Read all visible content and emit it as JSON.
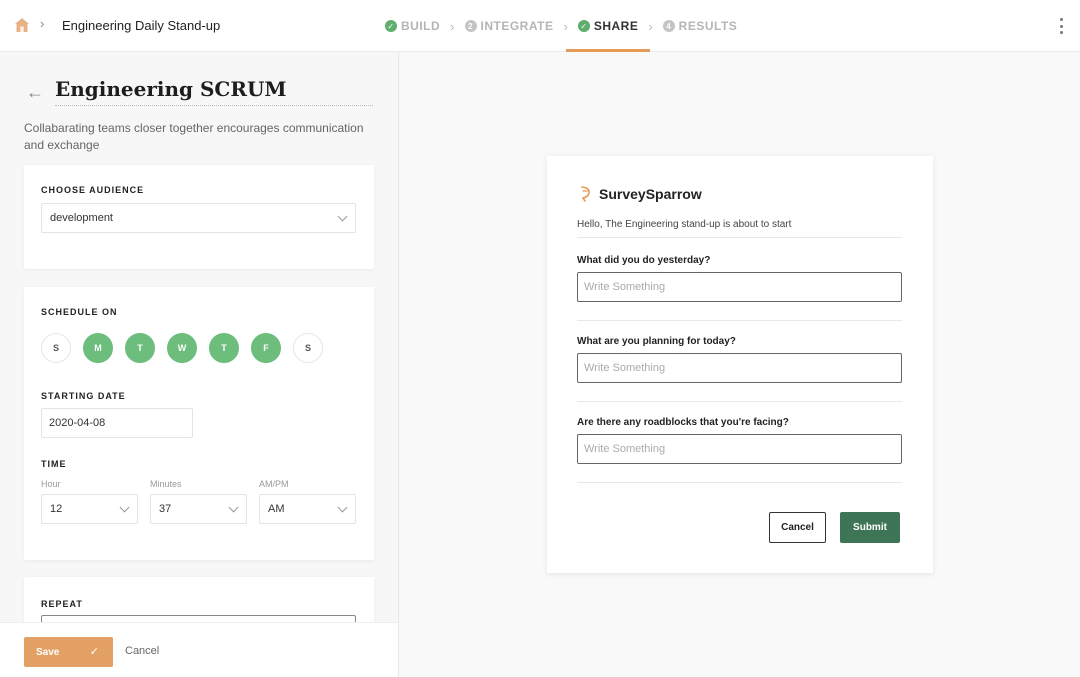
{
  "header": {
    "breadcrumb_title": "Engineering Daily Stand-up",
    "steps": [
      {
        "num": "",
        "label": "BUILD",
        "state": "done"
      },
      {
        "num": "2",
        "label": "INTEGRATE",
        "state": "pending"
      },
      {
        "num": "",
        "label": "SHARE",
        "state": "active"
      },
      {
        "num": "4",
        "label": "RESULTS",
        "state": "pending"
      }
    ]
  },
  "left": {
    "title": "Engineering SCRUM",
    "description": "Collabarating teams closer together encourages communication and exchange",
    "audience": {
      "label": "CHOOSE AUDIENCE",
      "value": "development"
    },
    "schedule": {
      "label": "SCHEDULE ON",
      "days": [
        {
          "d": "S",
          "on": false
        },
        {
          "d": "M",
          "on": true
        },
        {
          "d": "T",
          "on": true
        },
        {
          "d": "W",
          "on": true
        },
        {
          "d": "T",
          "on": true
        },
        {
          "d": "F",
          "on": true
        },
        {
          "d": "S",
          "on": false
        }
      ],
      "start_label": "STARTING DATE",
      "start_value": "2020-04-08",
      "time_label": "TIME",
      "hour_label": "Hour",
      "hour_value": "12",
      "minutes_label": "Minutes",
      "minutes_value": "37",
      "ampm_label": "AM/PM",
      "ampm_value": "AM"
    },
    "repeat_label": "REPEAT",
    "save_label": "Save",
    "cancel_label": "Cancel"
  },
  "preview": {
    "brand": "SurveySparrow",
    "greeting": "Hello, The Engineering stand-up is about to start",
    "questions": [
      {
        "q": "What did you do yesterday?",
        "placeholder": "Write Something"
      },
      {
        "q": "What are you planning for today?",
        "placeholder": "Write Something"
      },
      {
        "q": "Are there any roadblocks that you're facing?",
        "placeholder": "Write Something"
      }
    ],
    "cancel_label": "Cancel",
    "submit_label": "Submit"
  },
  "colors": {
    "accent": "#e59a56",
    "day_on": "#6dbd7c",
    "submit": "#3f7557"
  }
}
